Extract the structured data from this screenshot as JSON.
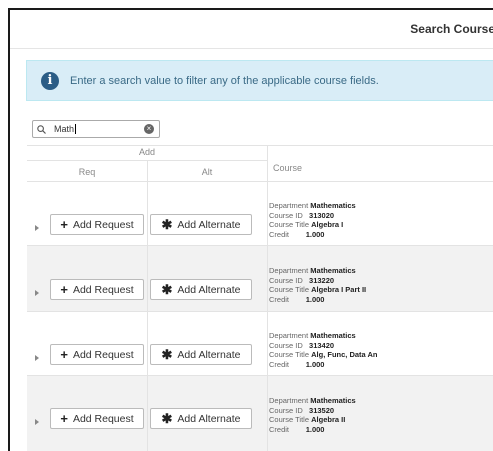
{
  "header": {
    "title": "Search Course"
  },
  "info": {
    "message": "Enter a search value to filter any of the applicable course fields."
  },
  "search": {
    "value": "Math"
  },
  "table": {
    "headers": {
      "add": "Add",
      "req": "Req",
      "alt": "Alt",
      "course": "Course"
    },
    "labels": {
      "department": "Department",
      "course_id": "Course ID",
      "course_title": "Course Title",
      "credit": "Credit"
    },
    "buttons": {
      "add_request": "Add Request",
      "add_alternate": "Add Alternate"
    },
    "rows": [
      {
        "department": "Mathematics",
        "course_id": "313020",
        "course_title": "Algebra I",
        "credit": "1.000"
      },
      {
        "department": "Mathematics",
        "course_id": "313220",
        "course_title": "Algebra I Part II",
        "credit": "1.000"
      },
      {
        "department": "Mathematics",
        "course_id": "313420",
        "course_title": "Alg, Func, Data An",
        "credit": "1.000"
      },
      {
        "department": "Mathematics",
        "course_id": "313520",
        "course_title": "Algebra II",
        "credit": "1.000"
      }
    ]
  },
  "colors": {
    "info_bg": "#d9edf7",
    "info_icon": "#2b5d86",
    "stripe": "#f2f2f2"
  }
}
